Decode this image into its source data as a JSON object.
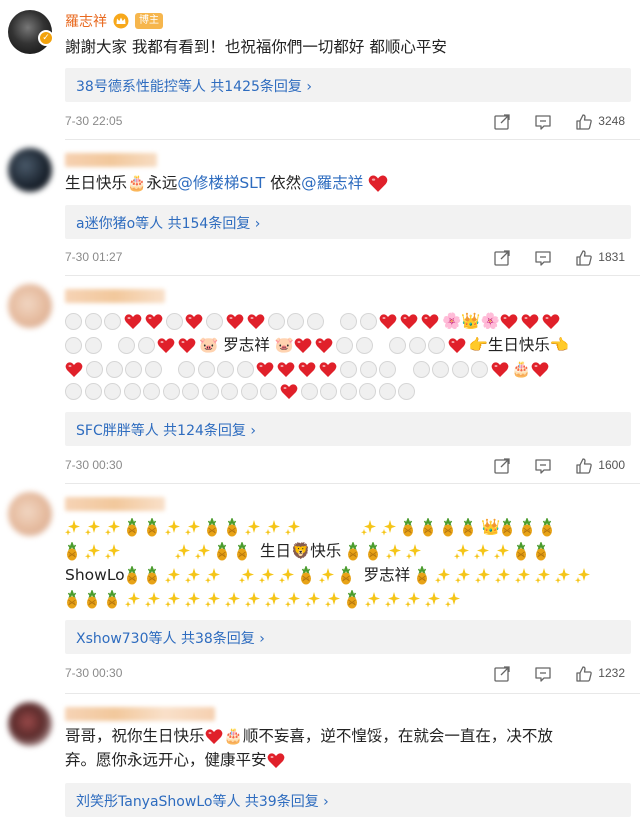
{
  "comments": [
    {
      "name": "羅志祥",
      "badge": "博主",
      "text": "謝謝大家 我都有看到！也祝福你們一切都好 都顺心平安",
      "replies": "38号德系性能控等人 共1425条回复 ›",
      "time": "7-30 22:05",
      "likes": "3248"
    },
    {
      "text_a": "生日快乐",
      "text_b": "永远",
      "mention_1": "@修楼梯SLT",
      "text_c": " 依然",
      "mention_2": "@羅志祥",
      "replies": "a迷你猪o等人 共154条回复 ›",
      "time": "7-30 01:27",
      "likes": "1831"
    },
    {
      "text_name": "罗志祥",
      "text_bday": "生日快乐",
      "replies": "SFC胖胖等人 共124条回复 ›",
      "time": "7-30 00:30",
      "likes": "1600"
    },
    {
      "text_bday_a": "生日",
      "text_bday_b": "快乐",
      "text_showlo": "ShowLo",
      "text_name": "罗志祥",
      "replies": "Xshow730等人 共38条回复 ›",
      "time": "7-30 00:30",
      "likes": "1232"
    },
    {
      "text_line1_a": "哥哥，祝你生日快乐",
      "text_line1_b": "顺不妄喜，逆不惶馁，在就会一直在，决不放",
      "text_line2": "弃。愿你永远开心，健康平安",
      "replies": "刘笑彤TanyaShowLo等人 共39条回复 ›"
    }
  ],
  "colors": {
    "link": "#2e6cbf",
    "author_name": "#e8691f",
    "badge": "#f6b64d",
    "heart": "#e0202a"
  },
  "icons": [
    "share-icon",
    "comment-icon",
    "like-icon",
    "crown-icon",
    "verified-icon"
  ]
}
